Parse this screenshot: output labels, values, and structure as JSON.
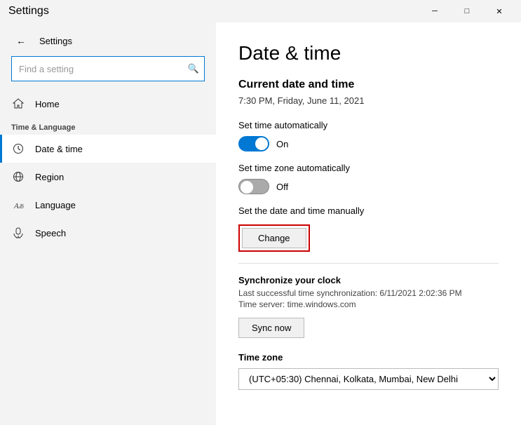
{
  "titlebar": {
    "title": "Settings",
    "minimize_label": "─",
    "maximize_label": "□",
    "close_label": "✕"
  },
  "sidebar": {
    "back_icon": "←",
    "header_title": "Settings",
    "search_placeholder": "Find a setting",
    "search_icon": "🔍",
    "section_label": "Time & Language",
    "nav_items": [
      {
        "id": "home",
        "icon": "⌂",
        "label": "Home"
      },
      {
        "id": "date-time",
        "icon": "🕐",
        "label": "Date & time",
        "active": true
      },
      {
        "id": "region",
        "icon": "◎",
        "label": "Region"
      },
      {
        "id": "language",
        "icon": "A",
        "label": "Language"
      },
      {
        "id": "speech",
        "icon": "🎤",
        "label": "Speech"
      }
    ]
  },
  "content": {
    "page_title": "Date & time",
    "current_section_label": "Current date and time",
    "current_datetime": "7:30 PM, Friday, June 11, 2021",
    "set_time_auto_label": "Set time automatically",
    "set_time_auto_state": "On",
    "set_time_auto_on": true,
    "set_timezone_auto_label": "Set time zone automatically",
    "set_timezone_auto_state": "Off",
    "set_timezone_auto_on": false,
    "set_manual_label": "Set the date and time manually",
    "change_btn_label": "Change",
    "sync_section_title": "Synchronize your clock",
    "sync_detail_1": "Last successful time synchronization: 6/11/2021 2:02:36 PM",
    "sync_detail_2": "Time server: time.windows.com",
    "sync_now_label": "Sync now",
    "timezone_label": "Time zone",
    "timezone_value": "(UTC+05:30) Chennai, Kolkata, Mumbai, New Delhi"
  }
}
